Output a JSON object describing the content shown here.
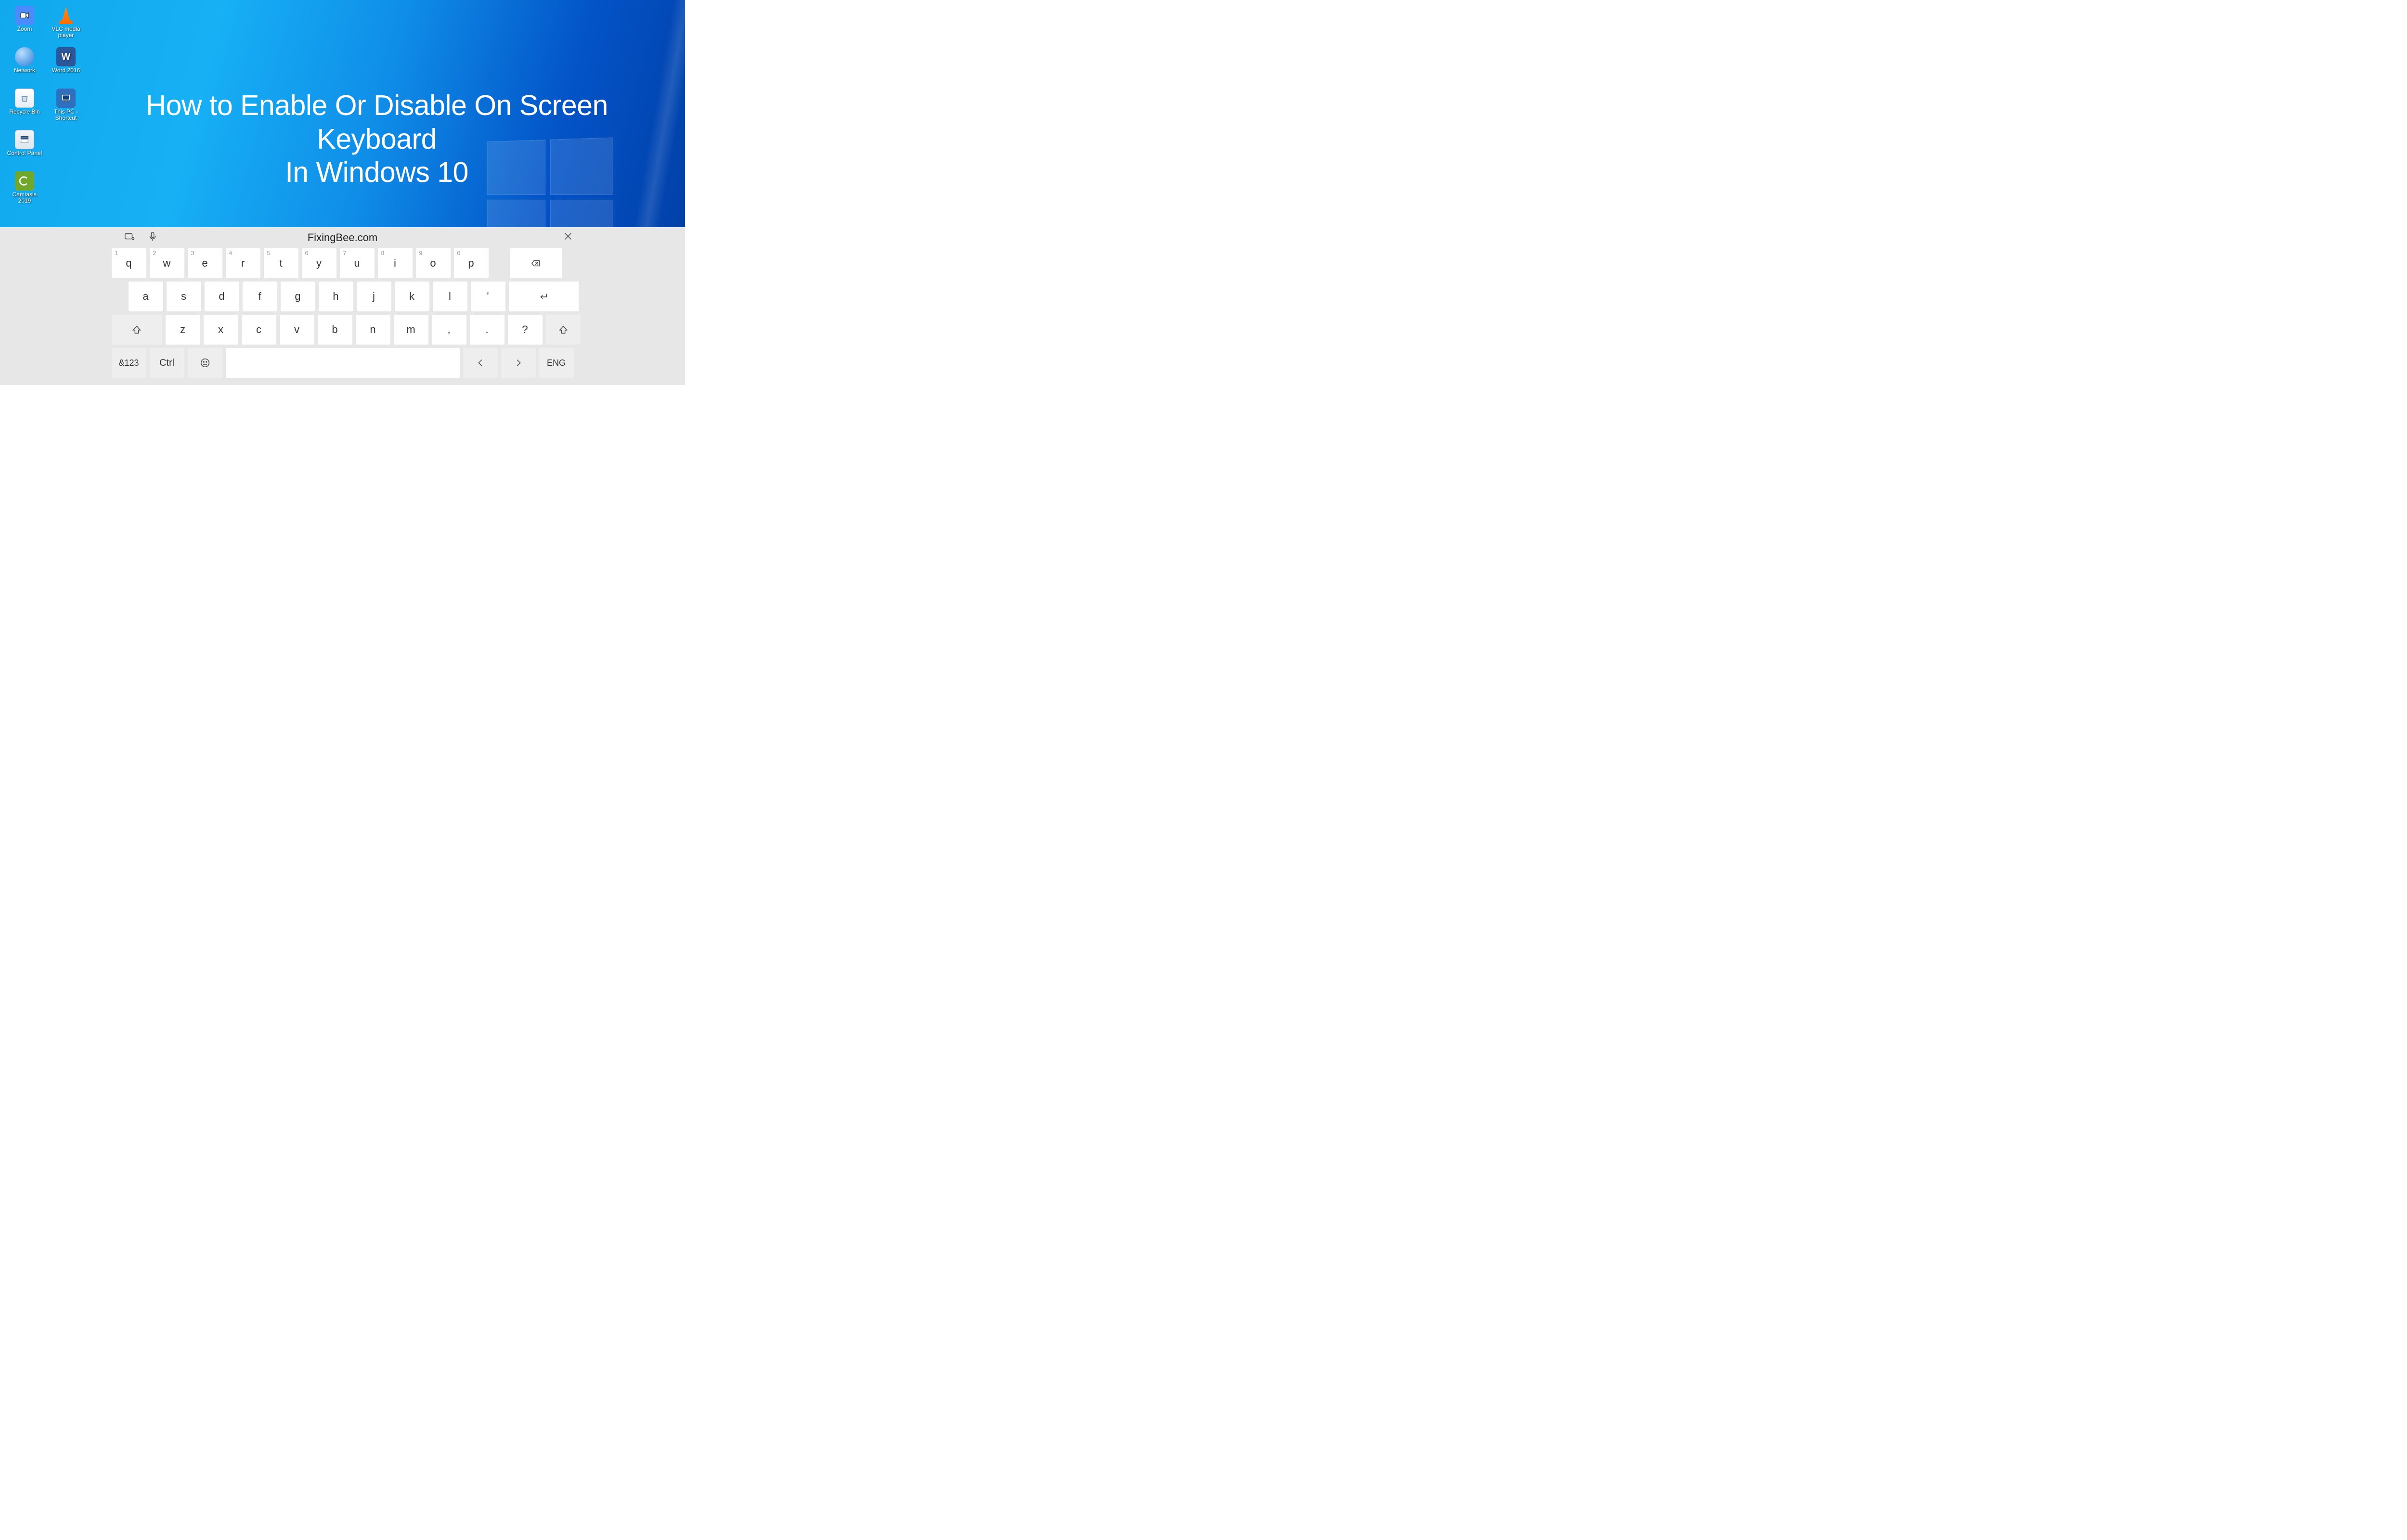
{
  "heading": {
    "line1": "How to Enable Or Disable On Screen Keyboard",
    "line2": "In Windows 10"
  },
  "desktop": {
    "icons": [
      {
        "name": "zoom",
        "label": "Zoom"
      },
      {
        "name": "vlc",
        "label": "VLC media player"
      },
      {
        "name": "network",
        "label": "Network"
      },
      {
        "name": "word",
        "label": "Word 2016"
      },
      {
        "name": "recycle",
        "label": "Recycle Bin"
      },
      {
        "name": "thispc",
        "label": "This PC - Shortcut"
      },
      {
        "name": "ctrlpanel",
        "label": "Control Panel"
      },
      {
        "name": "camtasia",
        "label": "Camtasia 2019"
      }
    ]
  },
  "keyboard": {
    "brand": "FixingBee.com",
    "row1": [
      {
        "k": "q",
        "sup": "1"
      },
      {
        "k": "w",
        "sup": "2"
      },
      {
        "k": "e",
        "sup": "3"
      },
      {
        "k": "r",
        "sup": "4"
      },
      {
        "k": "t",
        "sup": "5"
      },
      {
        "k": "y",
        "sup": "6"
      },
      {
        "k": "u",
        "sup": "7"
      },
      {
        "k": "i",
        "sup": "8"
      },
      {
        "k": "o",
        "sup": "9"
      },
      {
        "k": "p",
        "sup": "0"
      }
    ],
    "row2": [
      "a",
      "s",
      "d",
      "f",
      "g",
      "h",
      "j",
      "k",
      "l",
      "'"
    ],
    "row3": [
      "z",
      "x",
      "c",
      "v",
      "b",
      "n",
      "m",
      ",",
      ".",
      "?"
    ],
    "row4": {
      "symnum": "&123",
      "ctrl": "Ctrl",
      "lang": "ENG"
    }
  }
}
